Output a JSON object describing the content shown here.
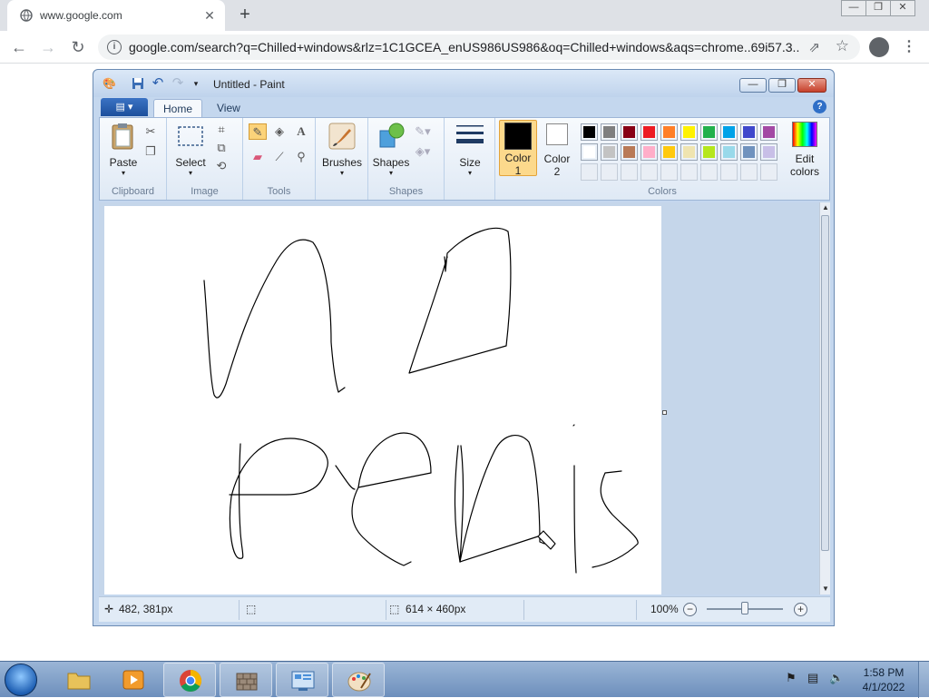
{
  "browser": {
    "tab_title": "www.google.com",
    "tab_close": "✕",
    "new_tab": "+",
    "url": "google.com/search?q=Chilled+windows&rlz=1C1GCEA_enUS986US986&oq=Chilled+windows&aqs=chrome..69i57.3...",
    "back": "←",
    "forward": "→",
    "reload": "↻",
    "star": "☆",
    "share": "⇗",
    "menu": "⋮",
    "window_controls": [
      "—",
      "❐",
      "✕"
    ]
  },
  "paint": {
    "window_title": "Untitled - Paint",
    "title_controls": [
      "—",
      "❐",
      "✕"
    ],
    "tabs": [
      {
        "label": "Home",
        "active": true
      },
      {
        "label": "View",
        "active": false
      }
    ],
    "file_menu": "▤ ▾",
    "help": "?",
    "groups": {
      "clipboard": {
        "label": "Clipboard",
        "paste": "Paste"
      },
      "image": {
        "label": "Image",
        "select": "Select"
      },
      "tools": {
        "label": "Tools"
      },
      "brushes": {
        "label": "Brushes"
      },
      "shapes": {
        "label": "Shapes"
      },
      "size": {
        "label": "Size"
      },
      "colors": {
        "label": "Colors",
        "color1": "Color\n1",
        "color1_a": "Color",
        "color1_b": "1",
        "color2_a": "Color",
        "color2_b": "2",
        "edit_a": "Edit",
        "edit_b": "colors"
      }
    },
    "palette_row1": [
      "#000000",
      "#7f7f7f",
      "#880015",
      "#ed1c24",
      "#ff7f27",
      "#fff200",
      "#22b14c",
      "#00a2e8",
      "#3f48cc",
      "#a349a4"
    ],
    "palette_row2": [
      "#ffffff",
      "#c3c3c3",
      "#b97a57",
      "#ffaec9",
      "#ffc90e",
      "#efe4b0",
      "#b5e61d",
      "#99d9ea",
      "#7092be",
      "#c8bfe7"
    ],
    "color1": "#000000",
    "color2": "#ffffff",
    "status": {
      "cursor_pos": "482, 381px",
      "canvas_size": "614 × 460px",
      "zoom": "100%",
      "zoom_out": "−",
      "zoom_in": "+"
    }
  },
  "taskbar": {
    "time": "1:58 PM",
    "date": "4/1/2022",
    "apps": [
      "explorer",
      "media-player",
      "chrome",
      "firewall",
      "control-panel",
      "paint"
    ]
  }
}
